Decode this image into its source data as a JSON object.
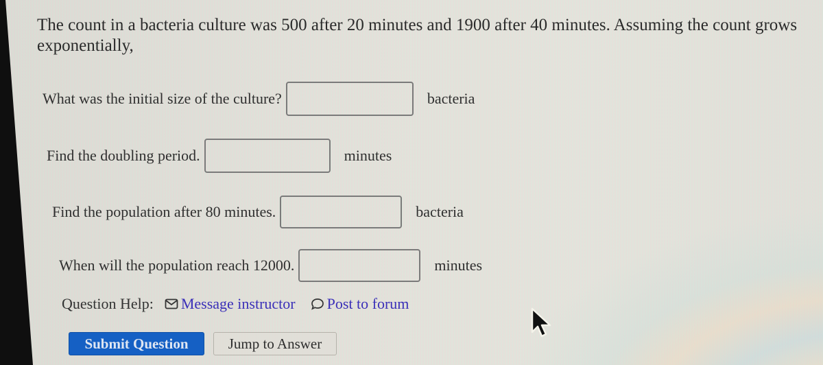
{
  "question": {
    "text": "The count in a bacteria culture was 500 after 20 minutes and 1900 after 40 minutes. Assuming the count grows exponentially,"
  },
  "parts": [
    {
      "prompt": "What was the initial size of the culture?",
      "value": "",
      "unit": "bacteria"
    },
    {
      "prompt": "Find the doubling period.",
      "value": "",
      "unit": "minutes"
    },
    {
      "prompt": "Find the population after 80 minutes.",
      "value": "",
      "unit": "bacteria"
    },
    {
      "prompt": "When will the population reach 12000.",
      "value": "",
      "unit": "minutes"
    }
  ],
  "help": {
    "label": "Question Help:",
    "message_instructor": "Message instructor",
    "message_icon": "envelope-icon",
    "post_to_forum": "Post to forum",
    "forum_icon": "speech-bubble-icon"
  },
  "buttons": {
    "submit": "Submit Question",
    "jump": "Jump to Answer"
  },
  "colors": {
    "primary_button": "#1560c4",
    "link": "#3a2fb8"
  }
}
